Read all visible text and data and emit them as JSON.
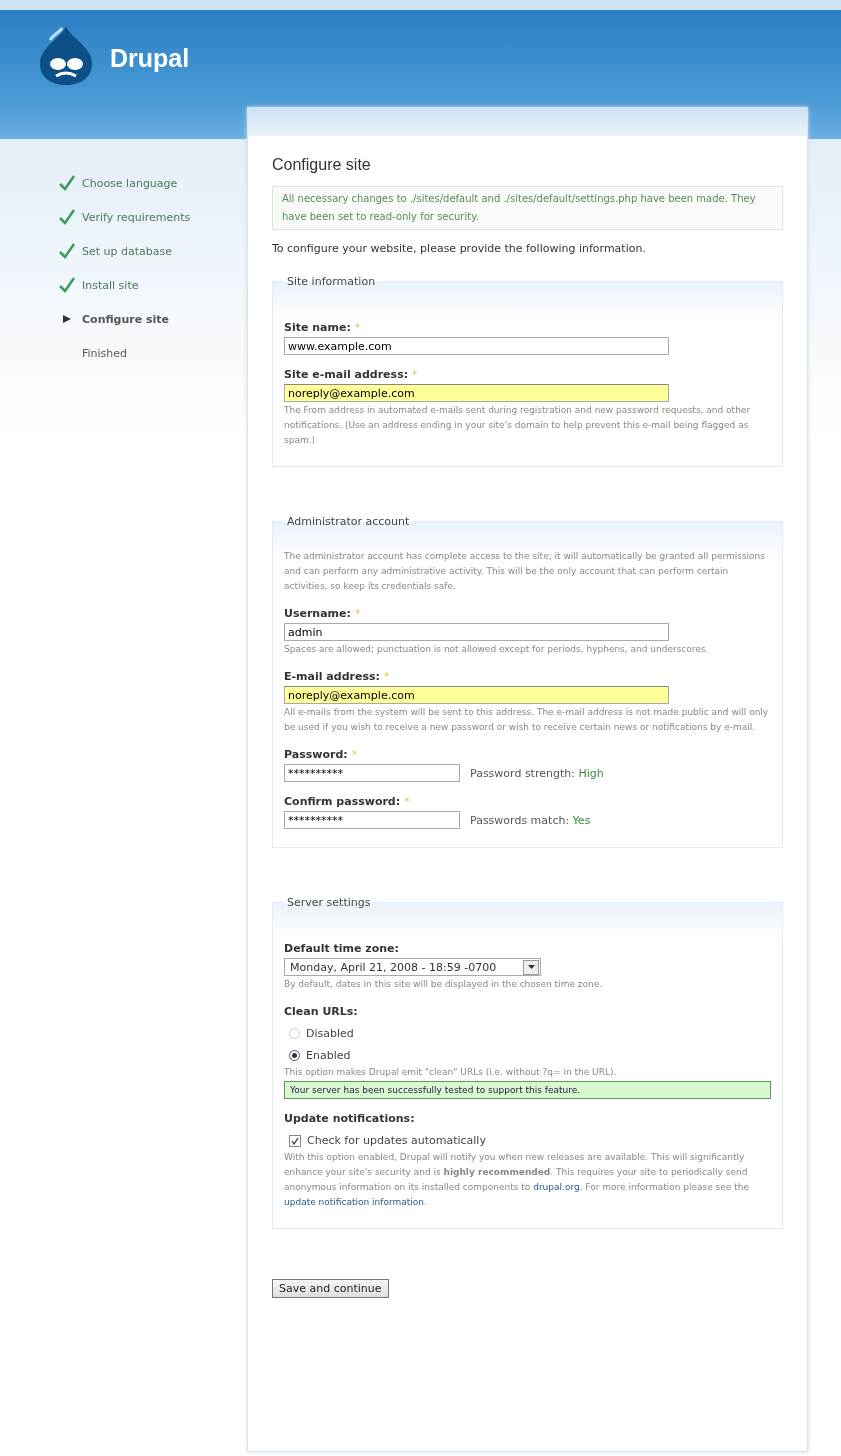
{
  "logo": {
    "name": "Drupal"
  },
  "steps": [
    {
      "label": "Choose language",
      "done": true,
      "selected": false
    },
    {
      "label": "Verify requirements",
      "done": true,
      "selected": false
    },
    {
      "label": "Set up database",
      "done": true,
      "selected": false
    },
    {
      "label": "Install site",
      "done": true,
      "selected": false
    },
    {
      "label": "Configure site",
      "done": false,
      "selected": true
    },
    {
      "label": "Finished",
      "done": false,
      "selected": false
    }
  ],
  "title": "Configure site",
  "message": "All necessary changes to ./sites/default and ./sites/default/settings.php have been made. They have been set to read-only for security.",
  "intro": "To configure your website, please provide the following information.",
  "sections": [
    {
      "legend": "Site information",
      "fields": [
        {
          "kind": "text",
          "label": "Site name:",
          "required_mark": "*",
          "value": "www.example.com",
          "highlighted": false
        },
        {
          "kind": "text",
          "label": "Site e-mail address:",
          "required_mark": "*",
          "value": "noreply@example.com",
          "highlighted": true,
          "description": "The From address in automated e-mails sent during registration and new password requests, and other notifications. (Use an address ending in your site's domain to help prevent this e-mail being flagged as spam.)"
        }
      ]
    },
    {
      "legend": "Administrator account",
      "description": "The administrator account has complete access to the site; it will automatically be granted all permissions and can perform any administrative activity. This will be the only account that can perform certain activities, so keep its credentials safe.",
      "fields": [
        {
          "kind": "text",
          "label": "Username:",
          "required_mark": "*",
          "value": "admin",
          "highlighted": false,
          "description": "Spaces are allowed; punctuation is not allowed except for periods, hyphens, and underscores."
        },
        {
          "kind": "text",
          "label": "E-mail address:",
          "required_mark": "*",
          "value": "noreply@example.com",
          "highlighted": true,
          "description": "All e-mails from the system will be sent to this address. The e-mail address is not made public and will only be used if you wish to receive a new password or wish to receive certain news or notifications by e-mail."
        },
        {
          "kind": "password",
          "label": "Password:",
          "required_mark": "*",
          "value": "**********",
          "status_label": "Password strength:",
          "status_value": "High"
        },
        {
          "kind": "password",
          "label": "Confirm password:",
          "required_mark": "*",
          "value": "**********",
          "status_label": "Passwords match:",
          "status_value": "Yes"
        }
      ]
    },
    {
      "legend": "Server settings",
      "fields": [
        {
          "kind": "select",
          "label": "Default time zone:",
          "value": "Monday, April 21, 2008 - 18:59 -0700",
          "description": "By default, dates in this site will be displayed in the chosen time zone."
        },
        {
          "kind": "radios",
          "label": "Clean URLs:",
          "options": [
            {
              "label": "Disabled",
              "selected": false
            },
            {
              "label": "Enabled",
              "selected": true
            }
          ],
          "description": "This option makes Drupal emit \"clean\" URLs (i.e. without ?q= in the URL).",
          "message": "Your server has been successfully tested to support this feature."
        },
        {
          "kind": "checkbox",
          "label": "Update notifications:",
          "option": "Check for updates automatically",
          "checked": true,
          "description": [
            {
              "kind": "text",
              "text": "With this option enabled, Drupal will notify you when new releases are available. This will significantly enhance your site's security and is **highly recommended**. This requires your site to periodically send anonymous information on its installed components to"
            },
            {
              "kind": "link",
              "text": "drupal.org"
            },
            {
              "kind": "text",
              "text": ". For more information please see the"
            },
            {
              "kind": "link",
              "text": "update notification information"
            },
            {
              "kind": "text",
              "text": "."
            }
          ]
        }
      ]
    }
  ],
  "submit": "Save and continue"
}
